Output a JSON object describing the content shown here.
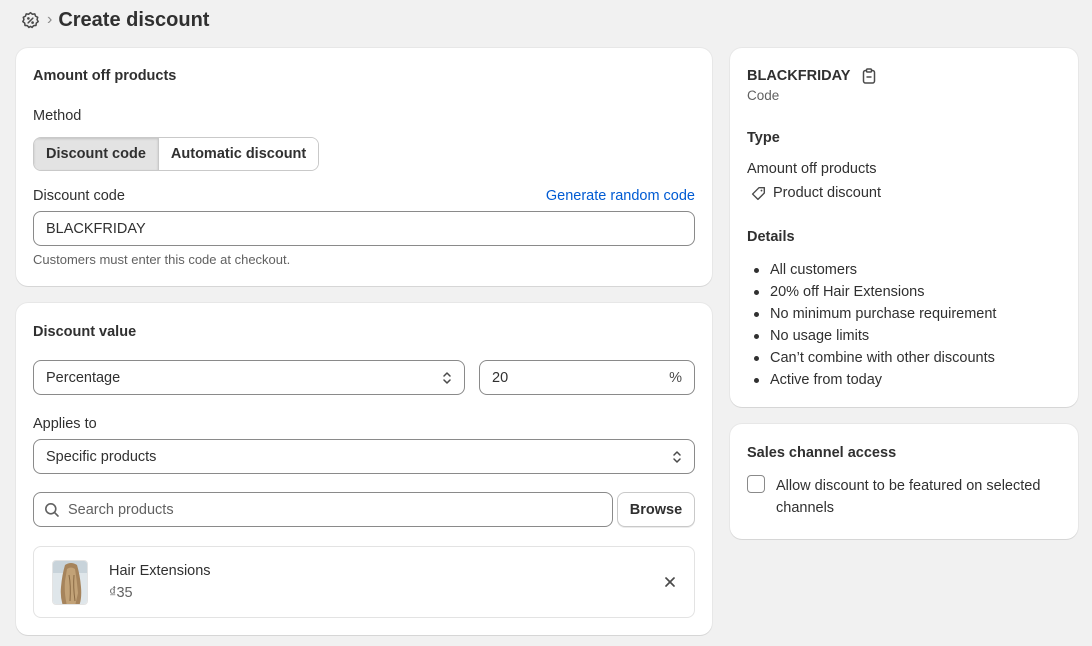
{
  "header": {
    "title": "Create discount",
    "separator": "›"
  },
  "method_card": {
    "title": "Amount off products",
    "method_label": "Method",
    "method_options": [
      "Discount code",
      "Automatic discount"
    ],
    "selected_method": "Discount code",
    "code_label": "Discount code",
    "generate_link": "Generate random code",
    "code_value": "BLACKFRIDAY",
    "help_text": "Customers must enter this code at checkout."
  },
  "value_card": {
    "title": "Discount value",
    "type_value": "Percentage",
    "amount_value": "20",
    "amount_suffix": "%",
    "applies_label": "Applies to",
    "applies_value": "Specific products",
    "search_placeholder": "Search products",
    "browse_label": "Browse",
    "product": {
      "name": "Hair Extensions",
      "price": "₫35"
    }
  },
  "summary_card": {
    "code": "BLACKFRIDAY",
    "code_caption": "Code",
    "type_heading": "Type",
    "type_value": "Amount off products",
    "type_kind": "Product discount",
    "details_heading": "Details",
    "details": [
      "All customers",
      "20% off Hair Extensions",
      "No minimum purchase requirement",
      "No usage limits",
      "Can’t combine with other discounts",
      "Active from today"
    ]
  },
  "channel_card": {
    "title": "Sales channel access",
    "checkbox_label_line1": "Allow discount to be featured on selected",
    "checkbox_label_line2": "channels",
    "checked": false
  },
  "colors": {
    "background": "#f1f1f1",
    "card": "#ffffff",
    "link": "#005bd3",
    "text": "#303030",
    "subdued": "#616161"
  }
}
